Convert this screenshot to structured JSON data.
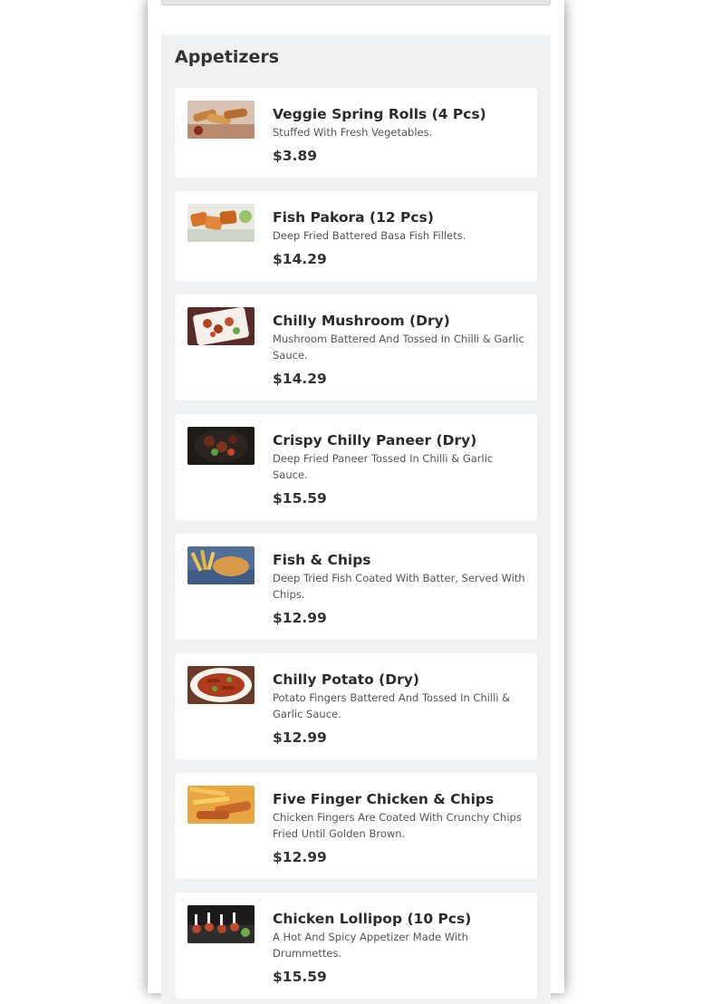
{
  "section": {
    "title": "Appetizers",
    "items": [
      {
        "name": "Veggie Spring Rolls (4 Pcs)",
        "description": "Stuffed With Fresh Vegetables.",
        "price": "$3.89",
        "image": "spring-rolls-image"
      },
      {
        "name": "Fish Pakora (12 Pcs)",
        "description": "Deep Fried Battered Basa Fish Fillets.",
        "price": "$14.29",
        "image": "fish-pakora-image"
      },
      {
        "name": "Chilly Mushroom (Dry)",
        "description": "Mushroom Battered And Tossed In Chilli & Garlic Sauce.",
        "price": "$14.29",
        "image": "chilly-mushroom-image"
      },
      {
        "name": "Crispy Chilly Paneer (Dry)",
        "description": "Deep Fried Paneer Tossed In Chilli & Garlic Sauce.",
        "price": "$15.59",
        "image": "chilly-paneer-image"
      },
      {
        "name": "Fish & Chips",
        "description": "Deep Tried Fish Coated With Batter, Served With Chips.",
        "price": "$12.99",
        "image": "fish-chips-image"
      },
      {
        "name": "Chilly Potato (Dry)",
        "description": "Potato Fingers Battered And Tossed In Chilli & Garlic Sauce.",
        "price": "$12.99",
        "image": "chilly-potato-image"
      },
      {
        "name": "Five Finger Chicken & Chips",
        "description": "Chicken Fingers Are Coated With Crunchy Chips Fried Until Golden Brown.",
        "price": "$12.99",
        "image": "chicken-fingers-image"
      },
      {
        "name": "Chicken Lollipop (10 Pcs)",
        "description": "A Hot And Spicy Appetizer Made With Drummettes.",
        "price": "$15.59",
        "image": "chicken-lollipop-image"
      }
    ]
  },
  "colors": {
    "section_bg": "#f0f1f3",
    "card_bg": "#ffffff",
    "text": "#333333"
  }
}
